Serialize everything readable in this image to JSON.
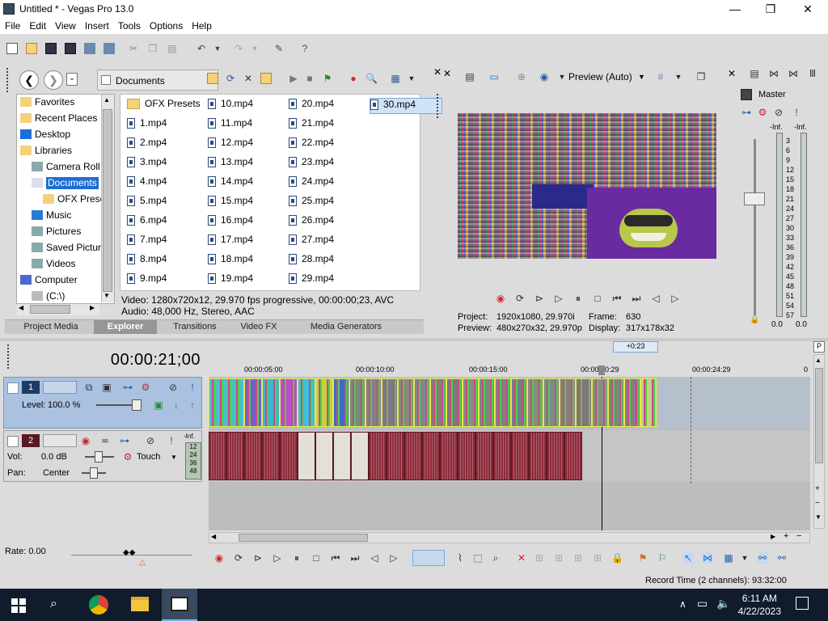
{
  "window": {
    "title": "Untitled * - Vegas Pro 13.0",
    "minimize": "—",
    "maximize": "❐",
    "close": "✕"
  },
  "menu": [
    "File",
    "Edit",
    "View",
    "Insert",
    "Tools",
    "Options",
    "Help"
  ],
  "explorer": {
    "address": "Documents",
    "tree": [
      {
        "label": "Favorites",
        "indent": 0,
        "icon": "star-folder-icon"
      },
      {
        "label": "Recent Places",
        "indent": 0,
        "icon": "recent-icon"
      },
      {
        "label": "Desktop",
        "indent": 0,
        "icon": "desktop-icon"
      },
      {
        "label": "Libraries",
        "indent": 0,
        "icon": "library-icon"
      },
      {
        "label": "Camera Roll",
        "indent": 1,
        "icon": "camera-roll-icon"
      },
      {
        "label": "Documents",
        "indent": 1,
        "icon": "documents-icon",
        "selected": true
      },
      {
        "label": "OFX Presets",
        "indent": 2,
        "icon": "folder-icon"
      },
      {
        "label": "Music",
        "indent": 1,
        "icon": "music-icon"
      },
      {
        "label": "Pictures",
        "indent": 1,
        "icon": "pictures-icon"
      },
      {
        "label": "Saved Pictures",
        "indent": 1,
        "icon": "saved-pictures-icon"
      },
      {
        "label": "Videos",
        "indent": 1,
        "icon": "videos-icon"
      },
      {
        "label": "Computer",
        "indent": 0,
        "icon": "computer-icon"
      },
      {
        "label": "(C:\\)",
        "indent": 1,
        "icon": "drive-icon"
      }
    ],
    "files": [
      [
        "OFX Presets",
        "1.mp4",
        "2.mp4",
        "3.mp4",
        "4.mp4",
        "5.mp4",
        "6.mp4",
        "7.mp4",
        "8.mp4",
        "9.mp4"
      ],
      [
        "10.mp4",
        "11.mp4",
        "12.mp4",
        "13.mp4",
        "14.mp4",
        "15.mp4",
        "16.mp4",
        "17.mp4",
        "18.mp4",
        "19.mp4"
      ],
      [
        "20.mp4",
        "21.mp4",
        "22.mp4",
        "23.mp4",
        "24.mp4",
        "25.mp4",
        "26.mp4",
        "27.mp4",
        "28.mp4",
        "29.mp4"
      ],
      [
        "30.mp4"
      ]
    ],
    "selected_file": "30.mp4",
    "info_video": "Video: 1280x720x12, 29.970 fps progressive, 00:00:00;23, AVC",
    "info_audio": "Audio: 48,000 Hz, Stereo, AAC"
  },
  "tabs": [
    "Project Media",
    "Explorer",
    "Transitions",
    "Video FX",
    "Media Generators"
  ],
  "active_tab": "Explorer",
  "preview": {
    "mode": "Preview (Auto)",
    "project_label": "Project:",
    "project": "1920x1080, 29.970i",
    "frame_label": "Frame:",
    "frame": "630",
    "preview_label": "Preview:",
    "preview": "480x270x32, 29.970p",
    "display_label": "Display:",
    "display": "317x178x32"
  },
  "master": {
    "title": "Master",
    "left_inf": "-Inf.",
    "right_inf": "-Inf.",
    "scale": [
      "3",
      "6",
      "9",
      "12",
      "15",
      "18",
      "21",
      "24",
      "27",
      "30",
      "33",
      "36",
      "39",
      "42",
      "45",
      "48",
      "51",
      "54",
      "57"
    ],
    "left_val": "0.0",
    "right_val": "0.0"
  },
  "timeline": {
    "timecode": "00:00:21;00",
    "cursor_label": "+0:23",
    "ruler": [
      "00:00:05:00",
      "00:00:10:00",
      "00:00:15:00",
      "00:00:20:29",
      "00:00:24:29",
      "0"
    ],
    "track1": {
      "number": "1",
      "level_label": "Level:",
      "level": "100.0 %"
    },
    "track2": {
      "number": "2",
      "vol_label": "Vol:",
      "vol": "0.0 dB",
      "pan_label": "Pan:",
      "pan": "Center",
      "mode": "Touch",
      "meter_inf": "-Inf.",
      "meter": [
        "12",
        "24",
        "36",
        "48"
      ]
    },
    "rate_label": "Rate: 0.00"
  },
  "status": {
    "record_time": "Record Time (2 channels): 93:32:00"
  },
  "taskbar": {
    "time": "6:11 AM",
    "date": "4/22/2023"
  }
}
